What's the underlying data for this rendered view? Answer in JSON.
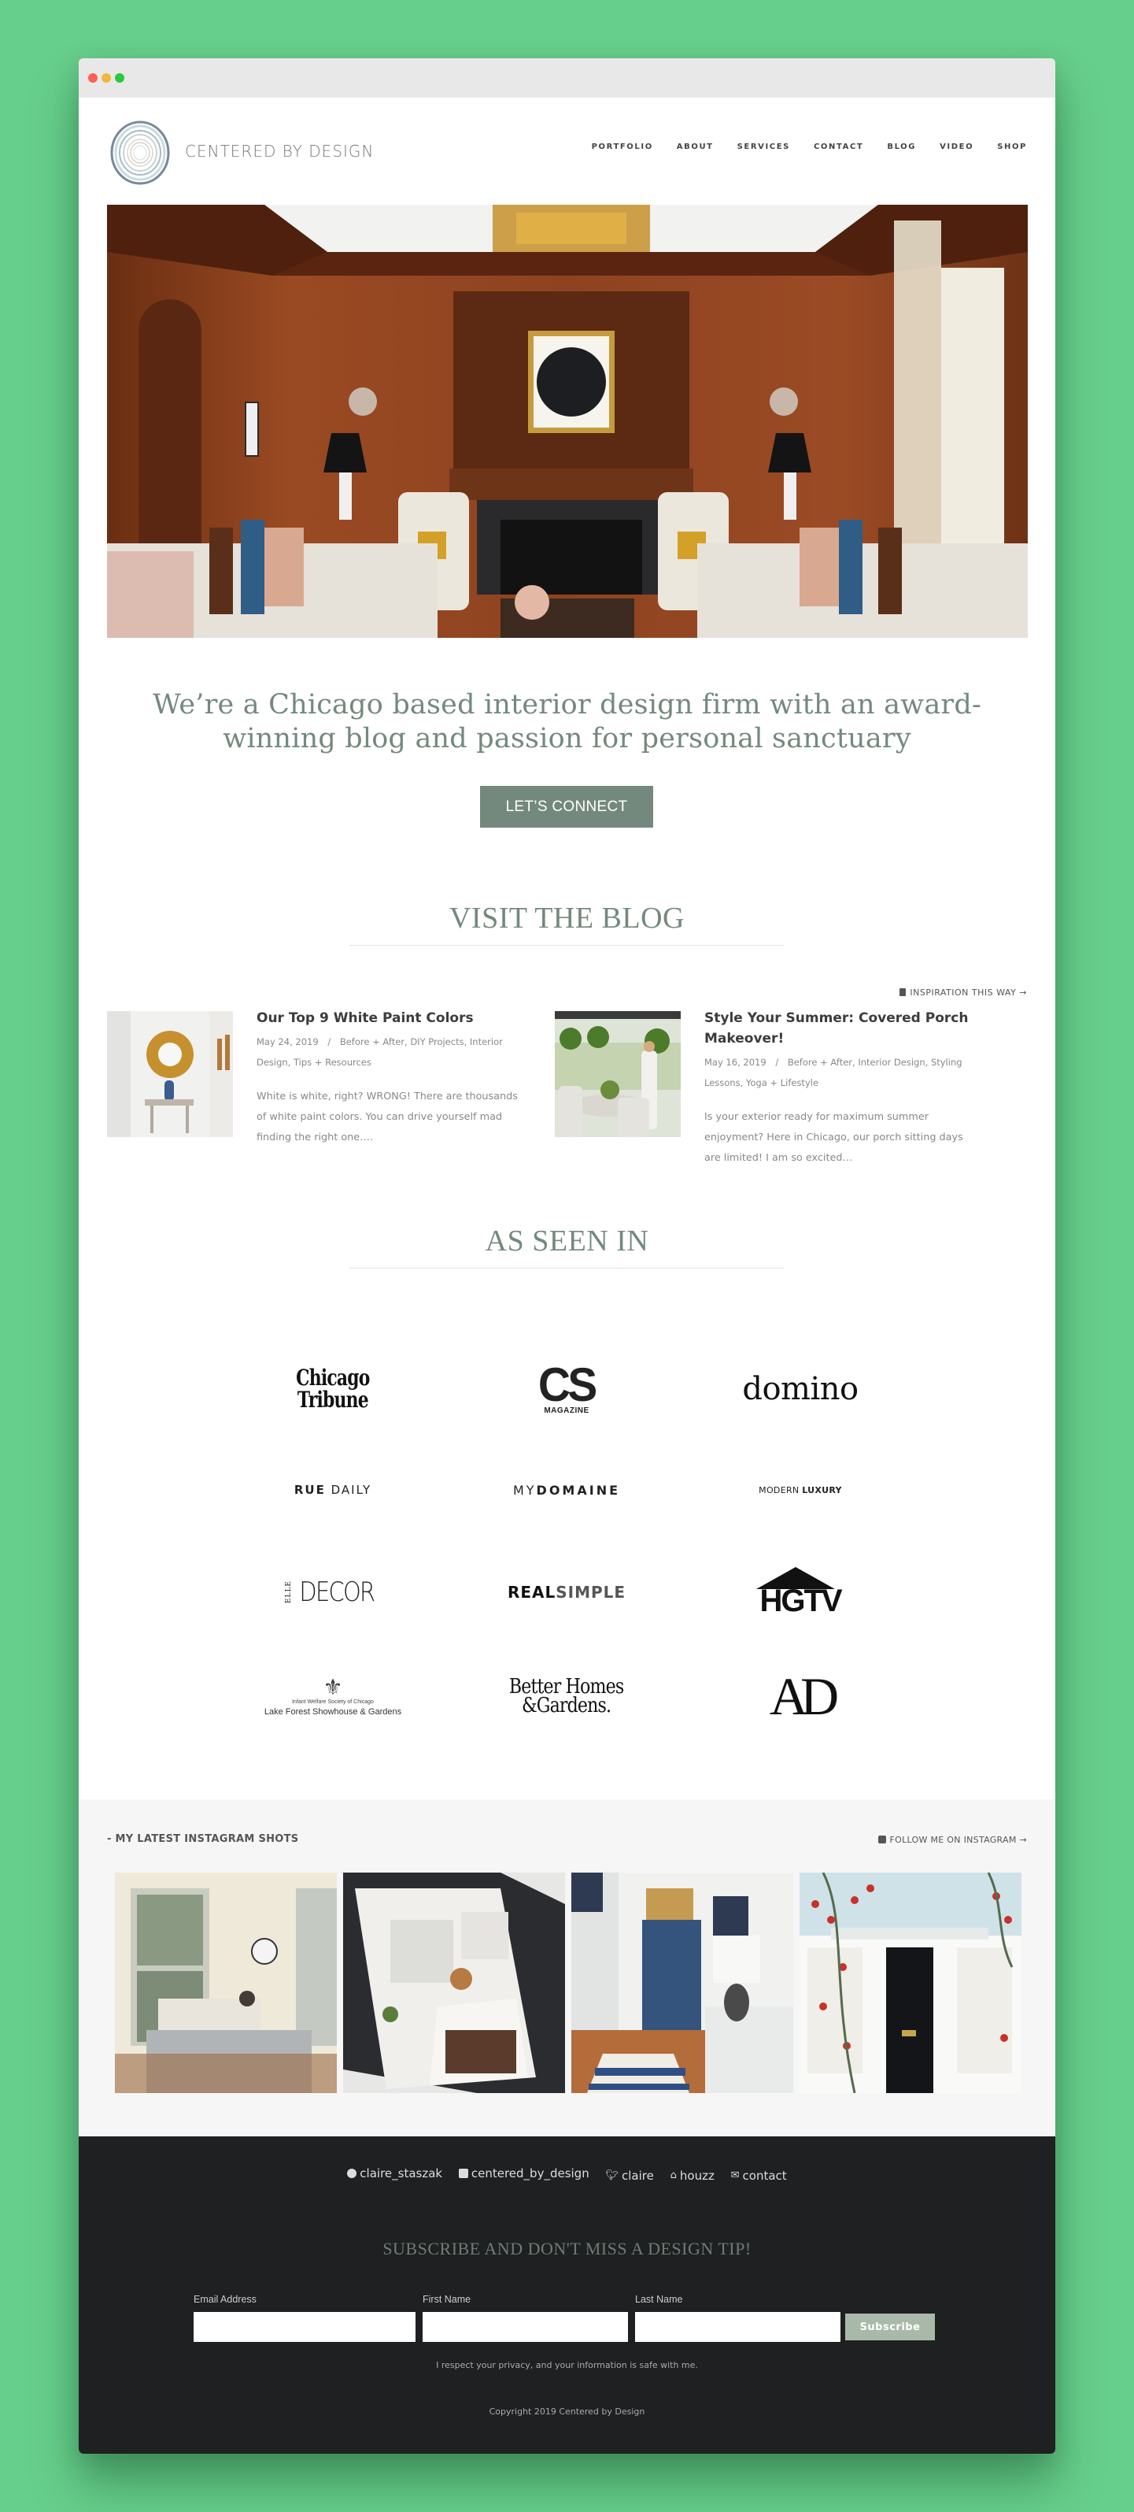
{
  "window": {
    "controls": [
      "close",
      "minimize",
      "maximize"
    ]
  },
  "brand": {
    "name": "CENTERED BY DESIGN",
    "logo_icon": "concentric-rings-logo"
  },
  "nav": {
    "items": [
      {
        "label": "PORTFOLIO"
      },
      {
        "label": "ABOUT"
      },
      {
        "label": "SERVICES"
      },
      {
        "label": "CONTACT"
      },
      {
        "label": "BLOG"
      },
      {
        "label": "VIDEO"
      },
      {
        "label": "SHOP"
      }
    ]
  },
  "hero": {
    "image": "wood-paneled-living-room-with-fireplace"
  },
  "intro": {
    "tagline_line1": "We’re a Chicago based interior design firm with an award-",
    "tagline_line2": "winning blog and passion for personal sanctuary",
    "cta_label": "LET’S CONNECT"
  },
  "blog": {
    "heading": "VISIT THE BLOG",
    "more_link": "INSPIRATION THIS WAY →",
    "more_icon": "document-icon",
    "posts": [
      {
        "title": "Our Top 9 White Paint Colors",
        "date": "May 24, 2019",
        "separator": "/",
        "categories_line1": "Before + After, DIY Projects, Interior",
        "categories_line2": "Design, Tips + Resources",
        "excerpt_line1": "White is white, right? WRONG! There are thousands",
        "excerpt_line2": "of white paint colors. You can drive yourself mad",
        "excerpt_line3": "finding the right one….",
        "thumb": "white-hallway-sunburst-mirror"
      },
      {
        "title_line1": "Style Your Summer: Covered Porch",
        "title_line2": "Makeover!",
        "date": "May 16, 2019",
        "separator": "/",
        "categories_line1": "Before + After, Interior Design, Styling",
        "categories_line2": "Lessons, Yoga + Lifestyle",
        "excerpt_line1": "Is your exterior ready for maximum summer",
        "excerpt_line2": "enjoyment? Here in Chicago, our porch sitting days",
        "excerpt_line3": "are limited! I am so excited…",
        "thumb": "covered-porch-with-ferns"
      }
    ]
  },
  "press": {
    "heading": "AS SEEN IN",
    "logos": [
      {
        "name": "Chicago Tribune",
        "line1": "Chicago",
        "line2": "Tribune"
      },
      {
        "name": "CS Magazine",
        "line1": "CS",
        "line2": "MAGAZINE"
      },
      {
        "name": "domino",
        "line1": "domino"
      },
      {
        "name": "Rue Daily",
        "line1": "RUE",
        "line2": "DAILY"
      },
      {
        "name": "MyDomaine",
        "line1": "MY",
        "line2": "DOMAINE"
      },
      {
        "name": "Modern Luxury",
        "line1": "MODERN",
        "line2": "LUXURY"
      },
      {
        "name": "Elle Decor",
        "line1": "ELLE",
        "line2": "DECOR"
      },
      {
        "name": "Real Simple",
        "line1": "REAL",
        "line2": "SIMPLE"
      },
      {
        "name": "HGTV",
        "line1": "HGTV"
      },
      {
        "name": "Lake Forest Showhouse & Gardens",
        "line1": "Infant Welfare Society of Chicago",
        "line2": "Lake Forest Showhouse & Gardens"
      },
      {
        "name": "Better Homes & Gardens",
        "line1": "Better Homes",
        "line2": "&Gardens."
      },
      {
        "name": "Architectural Digest",
        "line1": "AD"
      }
    ]
  },
  "instagram": {
    "heading": "- MY LATEST INSTAGRAM SHOTS",
    "follow_label": "FOLLOW ME ON INSTAGRAM →",
    "follow_icon": "instagram-icon",
    "shots": [
      {
        "alt": "sunroom-with-daybed"
      },
      {
        "alt": "kitchen-photo-on-phone"
      },
      {
        "alt": "blue-armoire-bedroom"
      },
      {
        "alt": "black-door-with-roses"
      }
    ]
  },
  "footer": {
    "social": [
      {
        "icon": "pinterest-icon",
        "label": "claire_staszak"
      },
      {
        "icon": "instagram-icon",
        "label": "centered_by_design"
      },
      {
        "icon": "twitter-icon",
        "label": "claire"
      },
      {
        "icon": "houzz-icon",
        "label": "houzz"
      },
      {
        "icon": "mail-icon",
        "label": "contact"
      }
    ],
    "subscribe_heading": "SUBSCRIBE AND DON'T MISS A DESIGN TIP!",
    "form": {
      "email_label": "Email Address",
      "email_value": "",
      "first_label": "First Name",
      "first_value": "",
      "last_label": "Last Name",
      "last_value": "",
      "submit_label": "Subscribe"
    },
    "privacy": "I respect your privacy, and your information is safe with me.",
    "copyright": "Copyright 2019 Centered by Design"
  },
  "colors": {
    "background": "#67cf8c",
    "accent": "#74897d",
    "footer": "#1f2022",
    "subscribe_button": "#a8b9aa"
  }
}
